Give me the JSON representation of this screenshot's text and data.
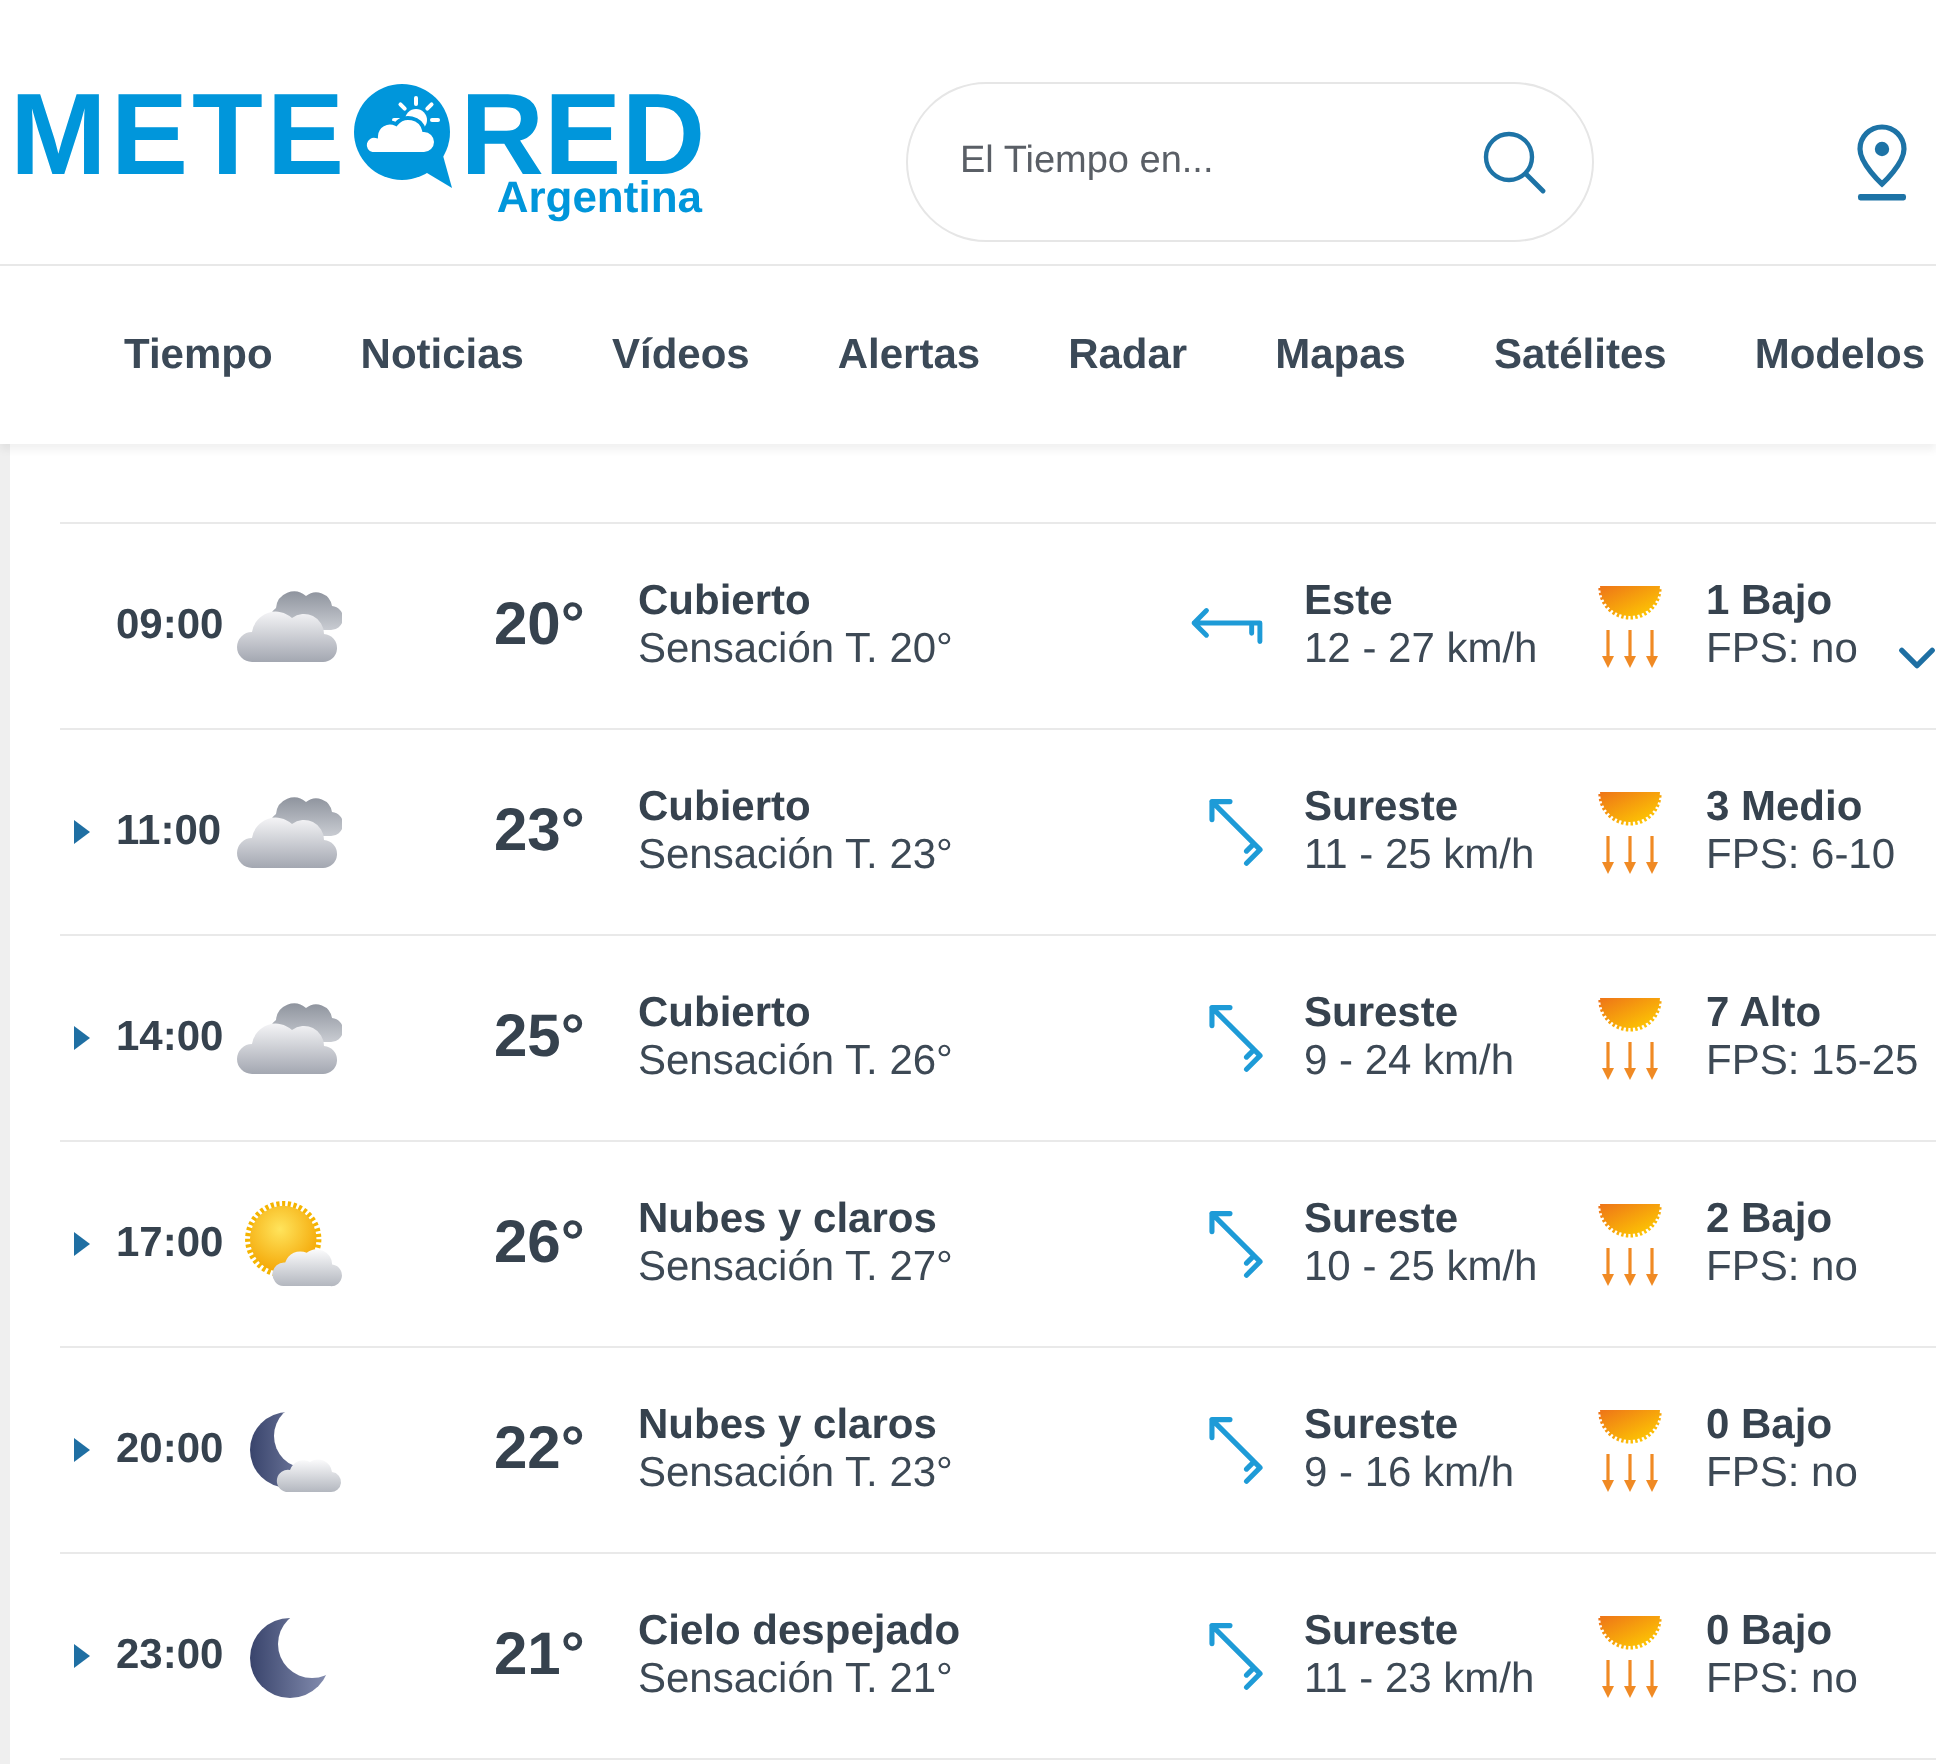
{
  "header": {
    "logo": {
      "wordmark_left": "METE",
      "wordmark_right": "RED",
      "region": "Argentina"
    },
    "search": {
      "placeholder": "El Tiempo en..."
    }
  },
  "nav": [
    {
      "label": "Tiempo"
    },
    {
      "label": "Noticias"
    },
    {
      "label": "Vídeos"
    },
    {
      "label": "Alertas"
    },
    {
      "label": "Radar"
    },
    {
      "label": "Mapas"
    },
    {
      "label": "Satélites"
    },
    {
      "label": "Modelos"
    }
  ],
  "hours": [
    {
      "kind": "chevron",
      "time": "09:00",
      "weather": {
        "kind": "overcast",
        "temperature": "20°",
        "condition": "Cubierto",
        "feels_like": "Sensación T. 20°"
      },
      "wind": {
        "kind": "east",
        "direction": "Este",
        "speed": "12 - 27 km/h"
      },
      "uv": {
        "index": "1 Bajo",
        "fps": "FPS: no"
      }
    },
    {
      "kind": "triangle",
      "time": "11:00",
      "weather": {
        "kind": "overcast",
        "temperature": "23°",
        "condition": "Cubierto",
        "feels_like": "Sensación T. 23°"
      },
      "wind": {
        "kind": "southeast",
        "direction": "Sureste",
        "speed": "11 - 25 km/h"
      },
      "uv": {
        "index": "3 Medio",
        "fps": "FPS: 6-10"
      }
    },
    {
      "kind": "triangle",
      "time": "14:00",
      "weather": {
        "kind": "overcast",
        "temperature": "25°",
        "condition": "Cubierto",
        "feels_like": "Sensación T. 26°"
      },
      "wind": {
        "kind": "southeast",
        "direction": "Sureste",
        "speed": "9 - 24 km/h"
      },
      "uv": {
        "index": "7 Alto",
        "fps": "FPS: 15-25"
      }
    },
    {
      "kind": "triangle",
      "time": "17:00",
      "weather": {
        "kind": "suncloud",
        "temperature": "26°",
        "condition": "Nubes y claros",
        "feels_like": "Sensación T. 27°"
      },
      "wind": {
        "kind": "southeast",
        "direction": "Sureste",
        "speed": "10 - 25 km/h"
      },
      "uv": {
        "index": "2 Bajo",
        "fps": "FPS: no"
      }
    },
    {
      "kind": "triangle",
      "time": "20:00",
      "weather": {
        "kind": "mooncloud",
        "temperature": "22°",
        "condition": "Nubes y claros",
        "feels_like": "Sensación T. 23°"
      },
      "wind": {
        "kind": "southeast",
        "direction": "Sureste",
        "speed": "9 - 16 km/h"
      },
      "uv": {
        "index": "0 Bajo",
        "fps": "FPS: no"
      }
    },
    {
      "kind": "triangle",
      "time": "23:00",
      "weather": {
        "kind": "moon",
        "temperature": "21°",
        "condition": "Cielo despejado",
        "feels_like": "Sensación T. 21°"
      },
      "wind": {
        "kind": "southeast",
        "direction": "Sureste",
        "speed": "11 - 23 km/h"
      },
      "uv": {
        "index": "0 Bajo",
        "fps": "FPS: no"
      }
    }
  ]
}
